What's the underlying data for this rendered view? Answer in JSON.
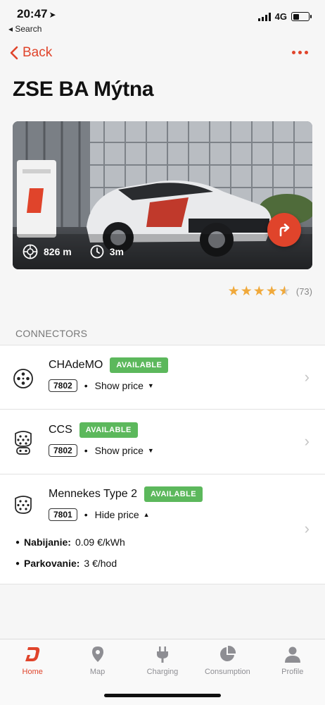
{
  "status": {
    "time": "20:47",
    "back_app": "◂ Search",
    "network": "4G"
  },
  "nav": {
    "back_label": "Back"
  },
  "station": {
    "title": "ZSE BA Mýtna",
    "distance": "826 m",
    "time": "3m",
    "rating_count": "(73)",
    "rating_value": 4.5
  },
  "connectors_section": {
    "header": "CONNECTORS",
    "items": [
      {
        "name": "CHAdeMO",
        "status": "AVAILABLE",
        "code": "7802",
        "price_toggle": "Show price"
      },
      {
        "name": "CCS",
        "status": "AVAILABLE",
        "code": "7802",
        "price_toggle": "Show price"
      },
      {
        "name": "Mennekes Type 2",
        "status": "AVAILABLE",
        "code": "7801",
        "price_toggle": "Hide price",
        "prices": [
          {
            "label": "Nabijanie:",
            "value": "0.09 €/kWh"
          },
          {
            "label": "Parkovanie:",
            "value": "3 €/hod"
          }
        ]
      }
    ]
  },
  "tabbar": {
    "tabs": [
      {
        "label": "Home",
        "icon": "home-logo-icon",
        "active": true
      },
      {
        "label": "Map",
        "icon": "map-pin-icon",
        "active": false
      },
      {
        "label": "Charging",
        "icon": "plug-icon",
        "active": false
      },
      {
        "label": "Consumption",
        "icon": "pie-chart-icon",
        "active": false
      },
      {
        "label": "Profile",
        "icon": "person-icon",
        "active": false
      }
    ]
  },
  "colors": {
    "accent": "#e0442b",
    "available": "#5cb85c",
    "star": "#f0a93b"
  }
}
